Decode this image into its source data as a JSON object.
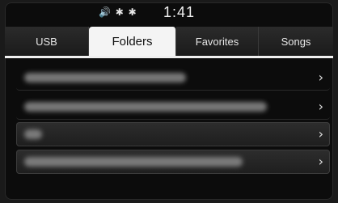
{
  "status": {
    "icons": "◀)ẏ✱",
    "time": "1:41"
  },
  "tabs": [
    {
      "label": "USB",
      "active": false
    },
    {
      "label": "Folders",
      "active": true
    },
    {
      "label": "Favorites",
      "active": false
    },
    {
      "label": "Songs",
      "active": false
    }
  ],
  "list": {
    "items": [
      {
        "label": "",
        "chevron": "›"
      },
      {
        "label": "",
        "chevron": "›"
      },
      {
        "label": "",
        "chevron": "›"
      },
      {
        "label": "",
        "chevron": "›"
      }
    ]
  }
}
